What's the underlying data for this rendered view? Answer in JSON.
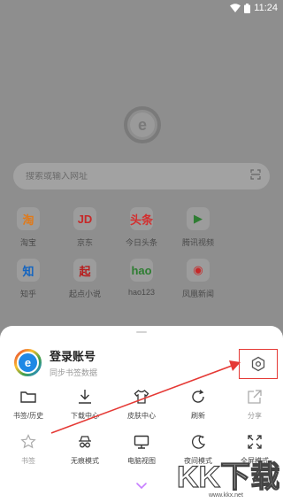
{
  "status_bar": {
    "time": "11:24"
  },
  "home": {
    "search_placeholder": "搜索或输入网址",
    "sites": [
      {
        "label": "淘宝",
        "glyph": "淘",
        "color": "#e07a1a"
      },
      {
        "label": "京东",
        "glyph": "JD",
        "color": "#c62828"
      },
      {
        "label": "今日头条",
        "glyph": "头条",
        "color": "#d32f2f"
      },
      {
        "label": "腾讯视频",
        "glyph": "▶",
        "color": "#2e7d32"
      },
      {
        "label": "",
        "glyph": "",
        "color": "#9c9c9c"
      },
      {
        "label": "知乎",
        "glyph": "知",
        "color": "#1565c0"
      },
      {
        "label": "起点小说",
        "glyph": "起",
        "color": "#b71c1c"
      },
      {
        "label": "hao123",
        "glyph": "hao",
        "color": "#2e7d32"
      },
      {
        "label": "凤凰新闻",
        "glyph": "◉",
        "color": "#c62828"
      },
      {
        "label": "",
        "glyph": "",
        "color": "#9c9c9c"
      }
    ]
  },
  "sheet": {
    "account_title": "登录账号",
    "account_subtitle": "同步书签数据",
    "items": [
      {
        "label": "书签/历史",
        "icon": "folder-icon",
        "disabled": false
      },
      {
        "label": "下载中心",
        "icon": "download-icon",
        "disabled": false
      },
      {
        "label": "皮肤中心",
        "icon": "tshirt-icon",
        "disabled": false
      },
      {
        "label": "刷新",
        "icon": "refresh-icon",
        "disabled": false
      },
      {
        "label": "分享",
        "icon": "share-icon",
        "disabled": true
      },
      {
        "label": "书签",
        "icon": "star-add-icon",
        "disabled": true
      },
      {
        "label": "无痕模式",
        "icon": "incognito-icon",
        "disabled": false
      },
      {
        "label": "电脑视图",
        "icon": "monitor-icon",
        "disabled": false
      },
      {
        "label": "夜间模式",
        "icon": "moon-icon",
        "disabled": false
      },
      {
        "label": "全屏模式",
        "icon": "fullscreen-icon",
        "disabled": false
      }
    ]
  },
  "watermark": {
    "text": "KK下载",
    "url": "www.kkx.net"
  },
  "colors": {
    "annotation_red": "#e53935",
    "brand_blue": "#1e88e5"
  }
}
